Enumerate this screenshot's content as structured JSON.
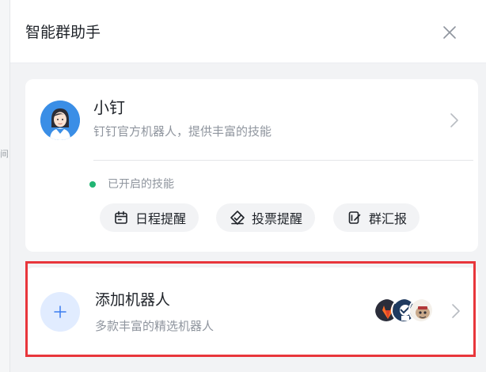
{
  "gutter": {
    "text": "间出"
  },
  "header": {
    "title": "智能群助手"
  },
  "bot": {
    "name": "小钉",
    "description": "钉钉官方机器人，提供丰富的技能",
    "status_label": "已开启的技能",
    "status_color": "#21b573",
    "skills": [
      {
        "label": "日程提醒",
        "icon": "calendar-icon"
      },
      {
        "label": "投票提醒",
        "icon": "vote-icon"
      },
      {
        "label": "群汇报",
        "icon": "report-icon"
      }
    ]
  },
  "add_robot": {
    "title": "添加机器人",
    "description": "多款丰富的精选机器人"
  },
  "colors": {
    "highlight_border": "#e8363b",
    "accent_blue": "#3a8ee6",
    "add_circle_bg": "#e1ecff"
  }
}
